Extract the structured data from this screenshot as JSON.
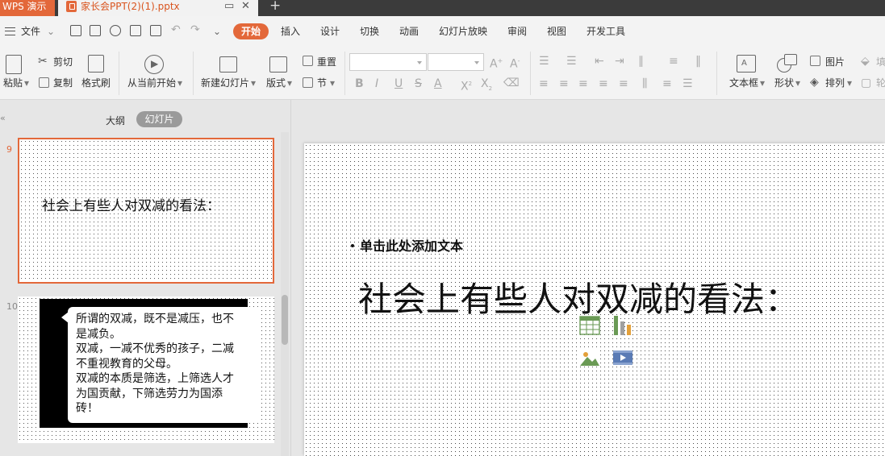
{
  "tabs": {
    "app_label": "WPS 演示",
    "doc_name": "家长会PPT(2)(1).pptx",
    "restore_glyph": "▭",
    "close_glyph": "✕",
    "new_tab_glyph": "+"
  },
  "menu": {
    "file_label": "文件",
    "items": [
      "开始",
      "插入",
      "设计",
      "切换",
      "动画",
      "幻灯片放映",
      "审阅",
      "视图",
      "开发工具"
    ]
  },
  "ribbon": {
    "paste": "粘贴",
    "cut": "剪切",
    "copy": "复制",
    "format_painter": "格式刷",
    "from_current": "从当前开始",
    "new_slide": "新建幻灯片",
    "layout": "版式",
    "reset": "重置",
    "section": "节",
    "textbox": "文本框",
    "shape": "形状",
    "picture": "图片",
    "arrange": "排列",
    "fill_partial": "填",
    "outline_partial": "轮"
  },
  "panel": {
    "tab_outline": "大纲",
    "tab_slides": "幻灯片"
  },
  "slides": [
    {
      "number": "9",
      "title": "社会上有些人对双减的看法："
    },
    {
      "number": "10",
      "text_lines": [
        "所谓的双减，既不是减压，也不",
        "是减负。",
        "双减，一减不优秀的孩子，二减",
        "不重视教育的父母。",
        "双减的本质是筛选，上筛选人才",
        "为国贡献，下筛选劳力为国添",
        "砖！"
      ]
    }
  ],
  "current_slide": {
    "placeholder_text": "单击此处添加文本",
    "title": "社会上有些人对双减的看法："
  },
  "colors": {
    "accent": "#e3683a",
    "titlebar": "#3b3b3b"
  }
}
